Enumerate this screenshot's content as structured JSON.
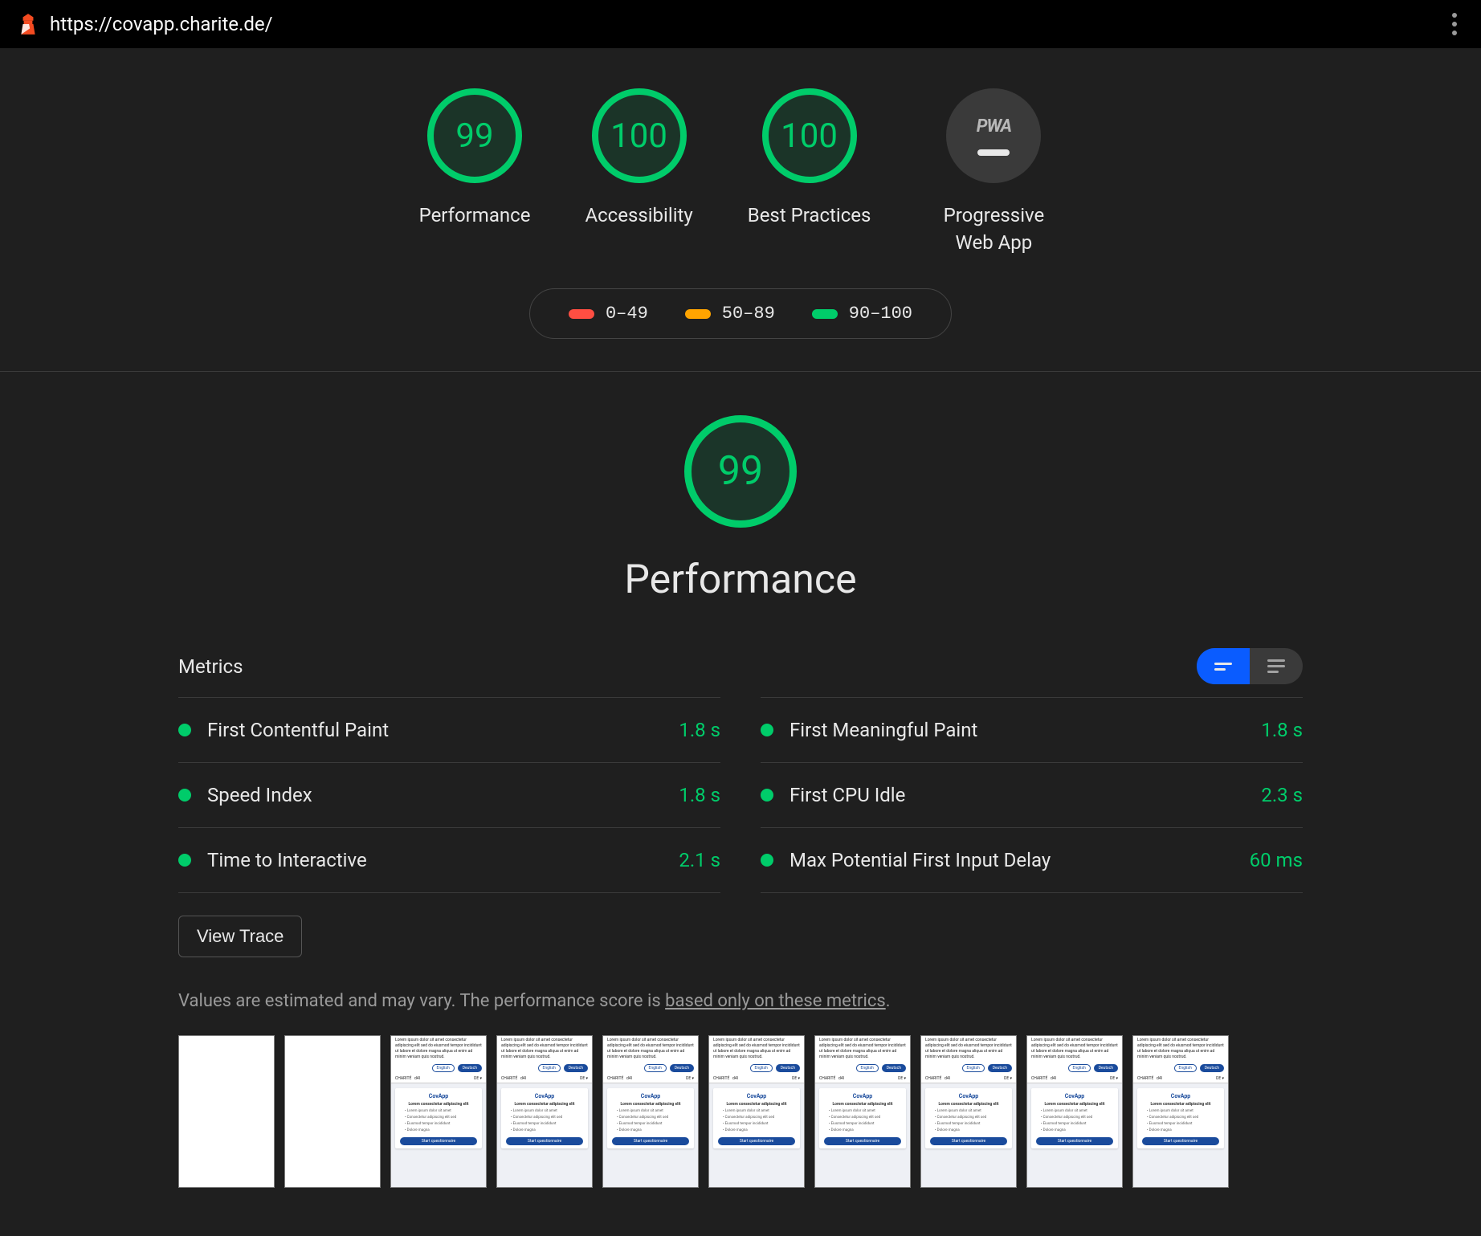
{
  "header": {
    "url": "https://covapp.charite.de/"
  },
  "overview": {
    "gauges": [
      {
        "score": "99",
        "label": "Performance"
      },
      {
        "score": "100",
        "label": "Accessibility"
      },
      {
        "score": "100",
        "label": "Best Practices"
      }
    ],
    "pwa_label": "Progressive Web App",
    "pwa_badge": "PWA"
  },
  "legend": {
    "bad": "0–49",
    "avg": "50–89",
    "good": "90–100"
  },
  "performance": {
    "score": "99",
    "title": "Performance",
    "metrics_heading": "Metrics",
    "metrics_left": [
      {
        "name": "First Contentful Paint",
        "value": "1.8 s"
      },
      {
        "name": "Speed Index",
        "value": "1.8 s"
      },
      {
        "name": "Time to Interactive",
        "value": "2.1 s"
      }
    ],
    "metrics_right": [
      {
        "name": "First Meaningful Paint",
        "value": "1.8 s"
      },
      {
        "name": "First CPU Idle",
        "value": "2.3 s"
      },
      {
        "name": "Max Potential First Input Delay",
        "value": "60 ms"
      }
    ],
    "view_trace": "View Trace",
    "disclaimer_prefix": "Values are estimated and may vary. The performance score is ",
    "disclaimer_link": "based only on these metrics",
    "disclaimer_suffix": ".",
    "filmstrip_frames": 10,
    "filmstrip_blank_leading": 2,
    "frame_app_title": "CovApp"
  }
}
